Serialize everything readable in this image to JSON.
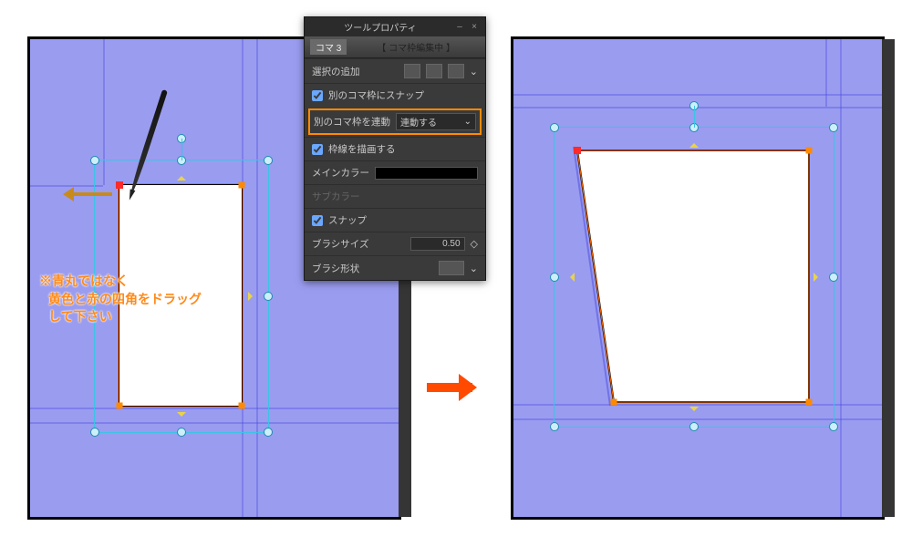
{
  "panel": {
    "title": "ツールプロパティ",
    "tab": "コマ 3",
    "header": "【 コマ枠編集中 】",
    "row_add_select": "選択の追加",
    "cb_snap_other": "別のコマ枠にスナップ",
    "link_label": "別のコマ枠を連動",
    "link_value": "連動する",
    "cb_draw_border": "枠線を描画する",
    "main_color": "メインカラー",
    "sub_color": "サブカラー",
    "cb_snap": "スナップ",
    "brush_size_label": "ブラシサイズ",
    "brush_size_value": "0.50",
    "brush_shape_label": "ブラシ形状"
  },
  "note_line1": "※青丸ではなく",
  "note_line2": "黄色と赤の四角をドラッグ",
  "note_line3": "して下さい",
  "icons": {
    "minimize": "–",
    "close": "×",
    "chevron": "⌄",
    "updown": "◇"
  }
}
